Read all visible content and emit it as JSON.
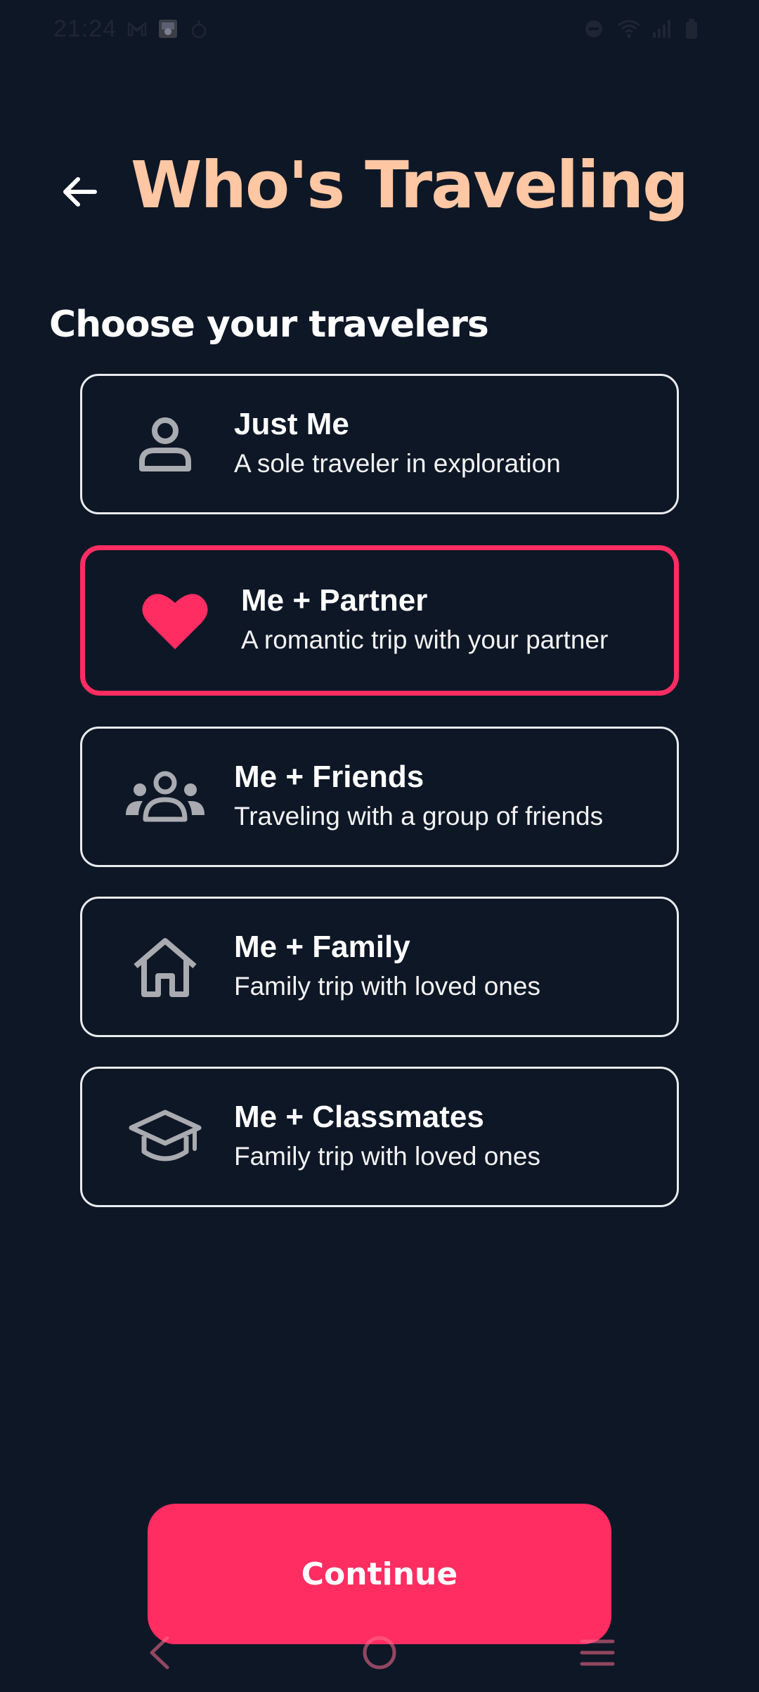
{
  "status_bar": {
    "time": "21:24",
    "left_icons": [
      "gmail-icon",
      "photo-thumbnail-icon",
      "notification-icon"
    ],
    "right_icons": [
      "dnd-icon",
      "wifi-icon",
      "signal-icon",
      "battery-icon"
    ]
  },
  "header": {
    "back_icon": "arrow-left-icon",
    "title": "Who's Traveling"
  },
  "section": {
    "heading": "Choose your travelers"
  },
  "options": [
    {
      "icon": "person-icon",
      "title": "Just Me",
      "subtitle": "A sole traveler in exploration",
      "selected": false
    },
    {
      "icon": "heart-icon",
      "title": "Me + Partner",
      "subtitle": "A romantic trip with your partner",
      "selected": true
    },
    {
      "icon": "group-icon",
      "title": "Me + Friends",
      "subtitle": "Traveling with a group of friends",
      "selected": false
    },
    {
      "icon": "home-icon",
      "title": "Me + Family",
      "subtitle": "Family trip with loved ones",
      "selected": false
    },
    {
      "icon": "graduation-cap-icon",
      "title": "Me + Classmates",
      "subtitle": "Family trip with loved ones",
      "selected": false
    }
  ],
  "continue_button": {
    "label": "Continue"
  },
  "nav_bar": {
    "back": "nav-back-icon",
    "home": "nav-home-icon",
    "menu": "nav-menu-icon"
  },
  "colors": {
    "background": "#0e1726",
    "title": "#ffc7a3",
    "accent": "#ff2d62",
    "card_border": "#e9ecef",
    "icon_gray": "#a9abb0"
  }
}
